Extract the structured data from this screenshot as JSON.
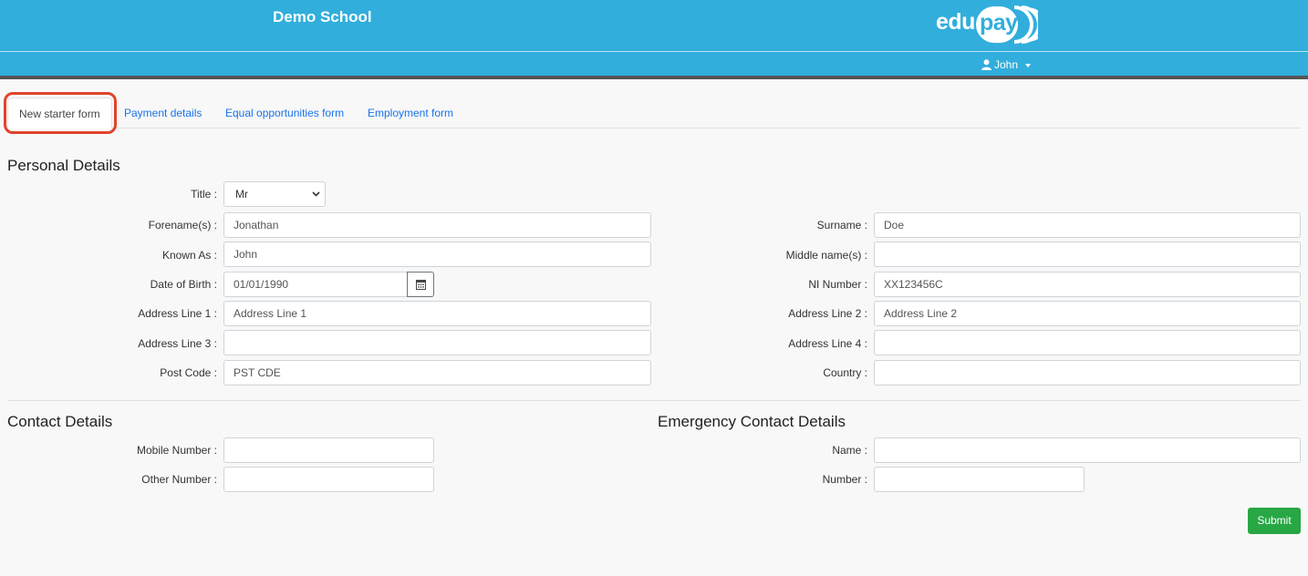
{
  "header": {
    "school_name": "Demo School",
    "logo": {
      "edu": "edu",
      "pay": "pay"
    },
    "user_name": "John"
  },
  "tabs": [
    {
      "label": "New starter form",
      "active": true
    },
    {
      "label": "Payment details",
      "active": false
    },
    {
      "label": "Equal opportunities form",
      "active": false
    },
    {
      "label": "Employment form",
      "active": false
    }
  ],
  "personal": {
    "heading": "Personal Details",
    "title_label": "Title :",
    "title_value": "Mr",
    "forename_label": "Forename(s) :",
    "forename_value": "Jonathan",
    "surname_label": "Surname :",
    "surname_value": "Doe",
    "known_as_label": "Known As :",
    "known_as_value": "John",
    "middle_label": "Middle name(s) :",
    "middle_value": "",
    "dob_label": "Date of Birth :",
    "dob_value": "01/01/1990",
    "ni_label": "NI Number :",
    "ni_value": "XX123456C",
    "addr1_label": "Address Line 1 :",
    "addr1_placeholder": "Address Line 1",
    "addr2_label": "Address Line 2 :",
    "addr2_placeholder": "Address Line 2",
    "addr3_label": "Address Line 3 :",
    "addr3_value": "",
    "addr4_label": "Address Line 4 :",
    "addr4_value": "",
    "postcode_label": "Post Code :",
    "postcode_value": "PST CDE",
    "country_label": "Country :",
    "country_value": ""
  },
  "contact": {
    "heading": "Contact Details",
    "mobile_label": "Mobile Number :",
    "mobile_value": "",
    "other_label": "Other Number :",
    "other_value": ""
  },
  "emergency": {
    "heading": "Emergency Contact Details",
    "name_label": "Name :",
    "name_value": "",
    "number_label": "Number :",
    "number_value": ""
  },
  "actions": {
    "submit_label": "Submit"
  },
  "colors": {
    "header_bg": "#31aedc",
    "submit_bg": "#28a745",
    "highlight": "#e0442a",
    "link": "#1a73e8"
  }
}
